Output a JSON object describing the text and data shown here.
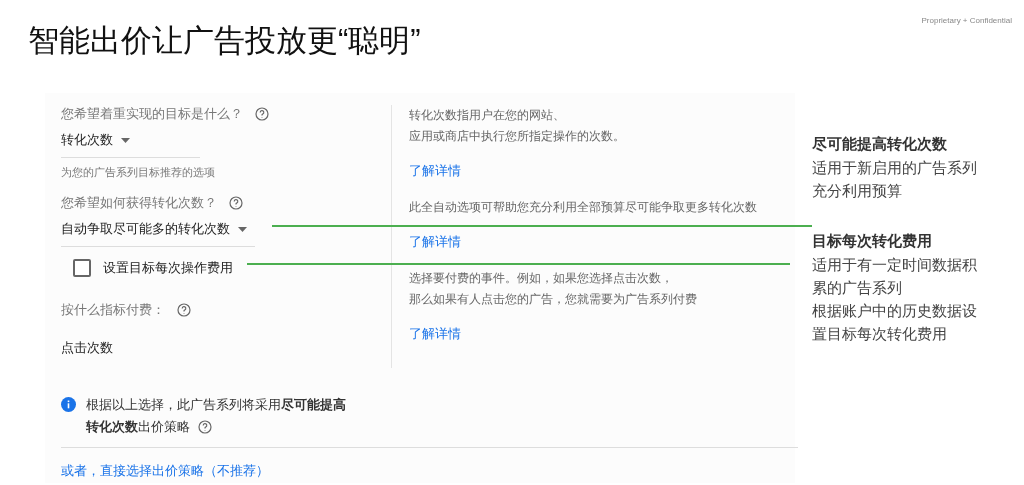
{
  "header": {
    "title": "智能出价让广告投放更“聪明”",
    "label": "Proprietary + Confidential"
  },
  "fields": [
    {
      "kind": "select",
      "label": "您希望着重实现的目标是什么？",
      "value": "转化次数",
      "hint": "为您的广告系列目标推荐的选项"
    },
    {
      "kind": "select",
      "label": "您希望如何获得转化次数？",
      "value": "自动争取尽可能多的转化次数"
    },
    {
      "kind": "checkbox",
      "label": "设置目标每次操作费用",
      "checked": false
    },
    {
      "kind": "static",
      "label": "按什么指标付费：",
      "value": "点击次数"
    }
  ],
  "descriptions": [
    {
      "lines": [
        "转化次数指用户在您的网站、",
        "应用或商店中执行您所指定操作的次数。"
      ],
      "link": "了解详情"
    },
    {
      "lines": [
        "此全自动选项可帮助您充分利用全部预算尽可能争取更多转化次数"
      ],
      "link": "了解详情"
    },
    {
      "lines": [
        "选择要付费的事件。例如，如果您选择点击次数，",
        "那么如果有人点击您的广告，您就需要为广告系列付费"
      ],
      "link": "了解详情"
    }
  ],
  "info": {
    "lines": [
      "根据以上选择，此广告系列将采用**尽可能提高**",
      "**转化次数**出价策略"
    ]
  },
  "alternative_link": "或者，直接选择出价策略（不推荐）",
  "notes": [
    {
      "title": "尽可能提高转化次数",
      "lines": [
        "适用于新启用的广告系列",
        "充分利用预算"
      ]
    },
    {
      "title": "目标每次转化费用",
      "lines": [
        "适用于有一定时间数据积",
        "累的广告系列",
        "根据账户中的历史数据设",
        "置目标每次转化费用"
      ]
    }
  ]
}
